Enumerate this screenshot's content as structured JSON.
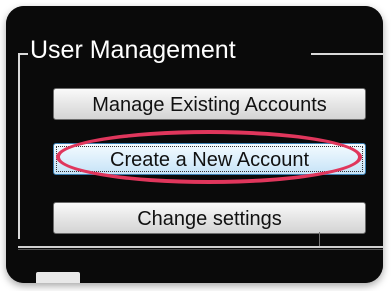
{
  "group": {
    "title": "User Management"
  },
  "buttons": {
    "manage_existing": "Manage Existing Accounts",
    "create_new": "Create a New Account",
    "change_settings": "Change settings"
  },
  "colors": {
    "background": "#0a0a0a",
    "highlight_oval": "#e0365c",
    "focused_button_border": "#3c7fb1"
  }
}
